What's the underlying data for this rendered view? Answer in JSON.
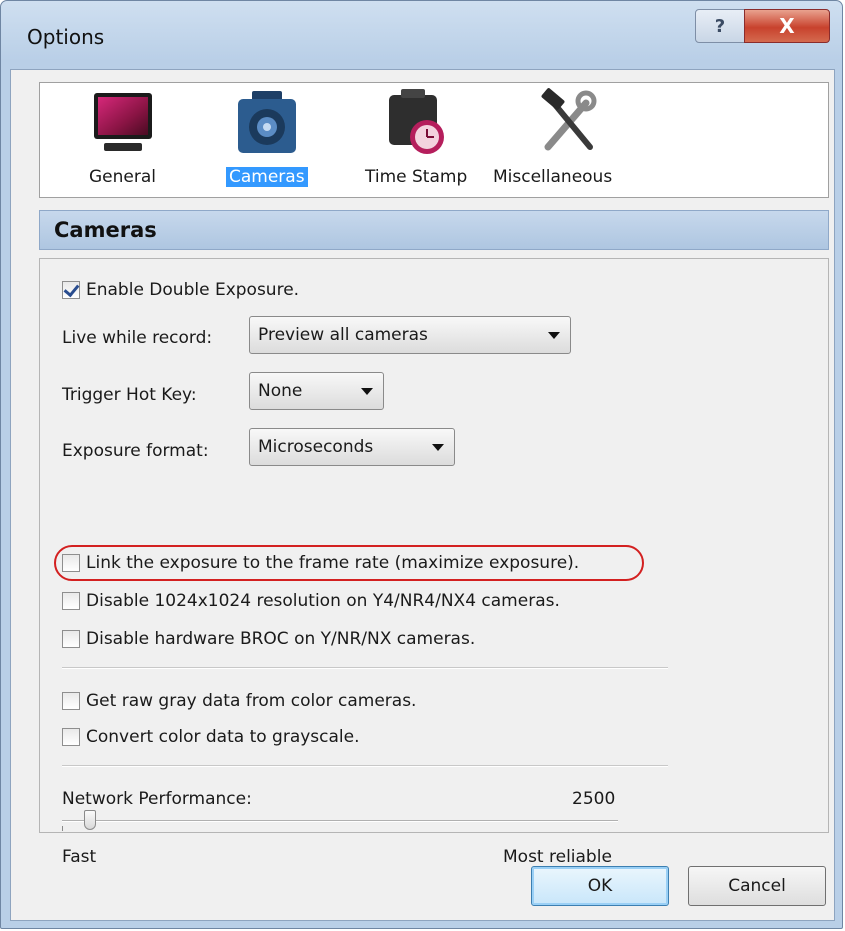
{
  "window": {
    "title": "Options",
    "help_glyph": "?",
    "close_glyph": "X"
  },
  "toolbar": {
    "items": [
      {
        "label": "General",
        "icon": "monitor-icon"
      },
      {
        "label": "Cameras",
        "icon": "camera-icon",
        "selected": true
      },
      {
        "label": "Time Stamp",
        "icon": "clock-icon"
      },
      {
        "label": "Miscellaneous",
        "icon": "tools-icon"
      }
    ]
  },
  "section": {
    "title": "Cameras"
  },
  "cameras": {
    "enable_double_exposure": {
      "label": "Enable Double Exposure.",
      "checked": true
    },
    "live_while_record": {
      "label": "Live while record:",
      "value": "Preview all cameras"
    },
    "trigger_hot_key": {
      "label": "Trigger Hot Key:",
      "value": "None"
    },
    "exposure_format": {
      "label": "Exposure format:",
      "value": "Microseconds"
    },
    "link_exposure": {
      "label": "Link the exposure to the frame rate (maximize exposure).",
      "checked": false
    },
    "disable_1024": {
      "label": "Disable 1024x1024 resolution on Y4/NR4/NX4 cameras.",
      "checked": false
    },
    "disable_broc": {
      "label": "Disable hardware BROC on Y/NR/NX cameras.",
      "checked": false
    },
    "raw_gray": {
      "label": "Get raw gray data from color cameras.",
      "checked": false
    },
    "convert_gray": {
      "label": "Convert color data to grayscale.",
      "checked": false
    },
    "network": {
      "label": "Network Performance:",
      "value": "2500",
      "min_label": "Fast",
      "max_label": "Most reliable",
      "level_fraction": 0.05
    }
  },
  "buttons": {
    "ok": "OK",
    "cancel": "Cancel"
  },
  "colors": {
    "selection": "#3399ff",
    "highlight_ring": "#d32020",
    "close_button": "#c8422d"
  }
}
